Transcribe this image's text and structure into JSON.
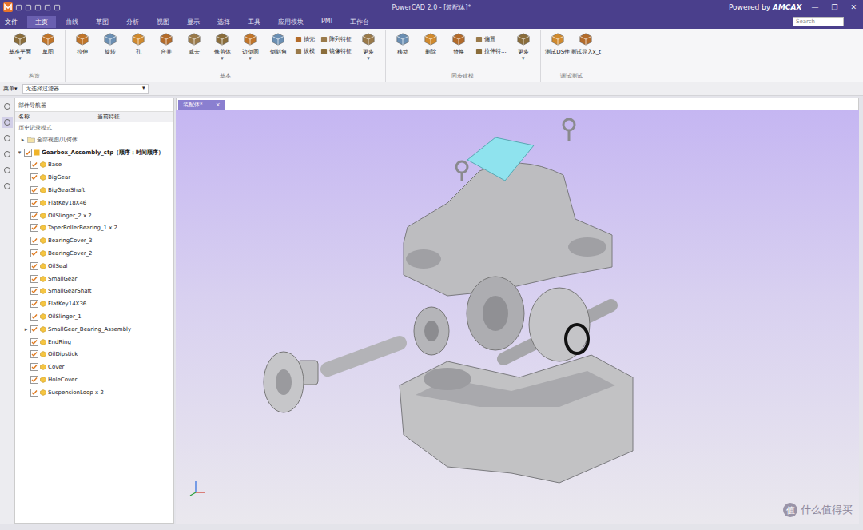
{
  "window": {
    "title": "PowerCAD 2.0 - [装配体]*",
    "powered_by": "Powered by",
    "brand": "AMCAX",
    "controls": [
      "—",
      "❐",
      "✕"
    ]
  },
  "menu": {
    "items": [
      {
        "label": "文件",
        "selected": false,
        "kind": "file"
      },
      {
        "label": "主页",
        "selected": true,
        "kind": "tab"
      },
      {
        "label": "曲线",
        "selected": false,
        "kind": "tab"
      },
      {
        "label": "草图",
        "selected": false,
        "kind": "tab"
      },
      {
        "label": "分析",
        "selected": false,
        "kind": "tab"
      },
      {
        "label": "视图",
        "selected": false,
        "kind": "tab"
      },
      {
        "label": "显示",
        "selected": false,
        "kind": "tab"
      },
      {
        "label": "选择",
        "selected": false,
        "kind": "tab"
      },
      {
        "label": "工具",
        "selected": false,
        "kind": "tab"
      },
      {
        "label": "应用模块",
        "selected": false,
        "kind": "tab"
      },
      {
        "label": "PMI",
        "selected": false,
        "kind": "tab"
      },
      {
        "label": "工作台",
        "selected": false,
        "kind": "tab"
      }
    ],
    "search": {
      "placeholder": "Search"
    }
  },
  "ribbon": {
    "dropdown_glyph": "▾",
    "groups": [
      {
        "label": "构造",
        "tools": [
          {
            "kind": "large",
            "label": "基准平面",
            "dropdown": true
          },
          {
            "kind": "large",
            "label": "草图",
            "dropdown": false
          }
        ]
      },
      {
        "label": "基本",
        "tools": [
          {
            "kind": "large",
            "label": "拉伸",
            "dropdown": false
          },
          {
            "kind": "large",
            "label": "旋转",
            "dropdown": false
          },
          {
            "kind": "large",
            "label": "孔",
            "dropdown": false
          },
          {
            "kind": "large",
            "label": "合并",
            "dropdown": false
          },
          {
            "kind": "large",
            "label": "减去",
            "dropdown": false
          },
          {
            "kind": "large",
            "label": "修剪体",
            "dropdown": true
          },
          {
            "kind": "large",
            "label": "边倒圆",
            "dropdown": true
          },
          {
            "kind": "large",
            "label": "倒斜角",
            "dropdown": false
          },
          {
            "kind": "stack",
            "items": [
              "抽壳",
              "拔模"
            ]
          },
          {
            "kind": "stack",
            "items": [
              "阵列特征",
              "镜像特征"
            ]
          },
          {
            "kind": "large",
            "label": "更多",
            "dropdown": true
          }
        ]
      },
      {
        "label": "同步建模",
        "tools": [
          {
            "kind": "large",
            "label": "移动",
            "dropdown": false
          },
          {
            "kind": "large",
            "label": "删除",
            "dropdown": false
          },
          {
            "kind": "large",
            "label": "替换",
            "dropdown": false
          },
          {
            "kind": "stack",
            "items": [
              "偏置",
              "拉伸特..."
            ]
          },
          {
            "kind": "large",
            "label": "更多",
            "dropdown": true
          }
        ]
      },
      {
        "label": "调试测试",
        "tools": [
          {
            "kind": "large",
            "label": "测试DS件",
            "dropdown": false
          },
          {
            "kind": "large",
            "label": "测试导入x_t",
            "dropdown": false
          }
        ]
      }
    ]
  },
  "filter_bar": {
    "menu": "菜单",
    "arrow": "▾",
    "filter": "无选择过滤器",
    "filter_arrow": "▾"
  },
  "navigator": {
    "title": "部件导航器",
    "columns": [
      "名称",
      "当前特征"
    ],
    "mode": "历史记录模式",
    "glyphs": {
      "expanded": "▾",
      "collapsed": "▸"
    },
    "view_node": {
      "label": "全部视图/几何体",
      "expanded": false
    },
    "root": {
      "label": "Gearbox_Assembly_stp（顺序：时间顺序）",
      "expanded": true,
      "checked": true
    },
    "items": [
      {
        "label": "Base",
        "checked": true,
        "expandable": false
      },
      {
        "label": "BigGear",
        "checked": true,
        "expandable": false
      },
      {
        "label": "BigGearShaft",
        "checked": true,
        "expandable": false
      },
      {
        "label": "FlatKey18X46",
        "checked": true,
        "expandable": false
      },
      {
        "label": "OilSlinger_2 x 2",
        "checked": true,
        "expandable": false
      },
      {
        "label": "TaperRollerBearing_1 x 2",
        "checked": true,
        "expandable": false
      },
      {
        "label": "BearingCover_3",
        "checked": true,
        "expandable": false
      },
      {
        "label": "BearingCover_2",
        "checked": true,
        "expandable": false
      },
      {
        "label": "OilSeal",
        "checked": true,
        "expandable": false
      },
      {
        "label": "SmallGear",
        "checked": true,
        "expandable": false
      },
      {
        "label": "SmallGearShaft",
        "checked": true,
        "expandable": false
      },
      {
        "label": "FlatKey14X36",
        "checked": true,
        "expandable": false
      },
      {
        "label": "OilSlinger_1",
        "checked": true,
        "expandable": false
      },
      {
        "label": "SmallGear_Bearing_Assembly",
        "checked": true,
        "expandable": true
      },
      {
        "label": "EndRing",
        "checked": true,
        "expandable": false
      },
      {
        "label": "OilDipstick",
        "checked": true,
        "expandable": false
      },
      {
        "label": "Cover",
        "checked": true,
        "expandable": false
      },
      {
        "label": "HoleCover",
        "checked": true,
        "expandable": false
      },
      {
        "label": "SuspensionLoop x 2",
        "checked": true,
        "expandable": false
      }
    ]
  },
  "side_strip": [
    {
      "selected": false
    },
    {
      "selected": true
    },
    {
      "selected": false
    },
    {
      "selected": false
    },
    {
      "selected": false
    },
    {
      "selected": false
    }
  ],
  "viewport": {
    "tab": {
      "label": "装配体*",
      "close": "×",
      "selected": true
    }
  },
  "watermark": {
    "badge": "值",
    "text": "什么值得买"
  }
}
